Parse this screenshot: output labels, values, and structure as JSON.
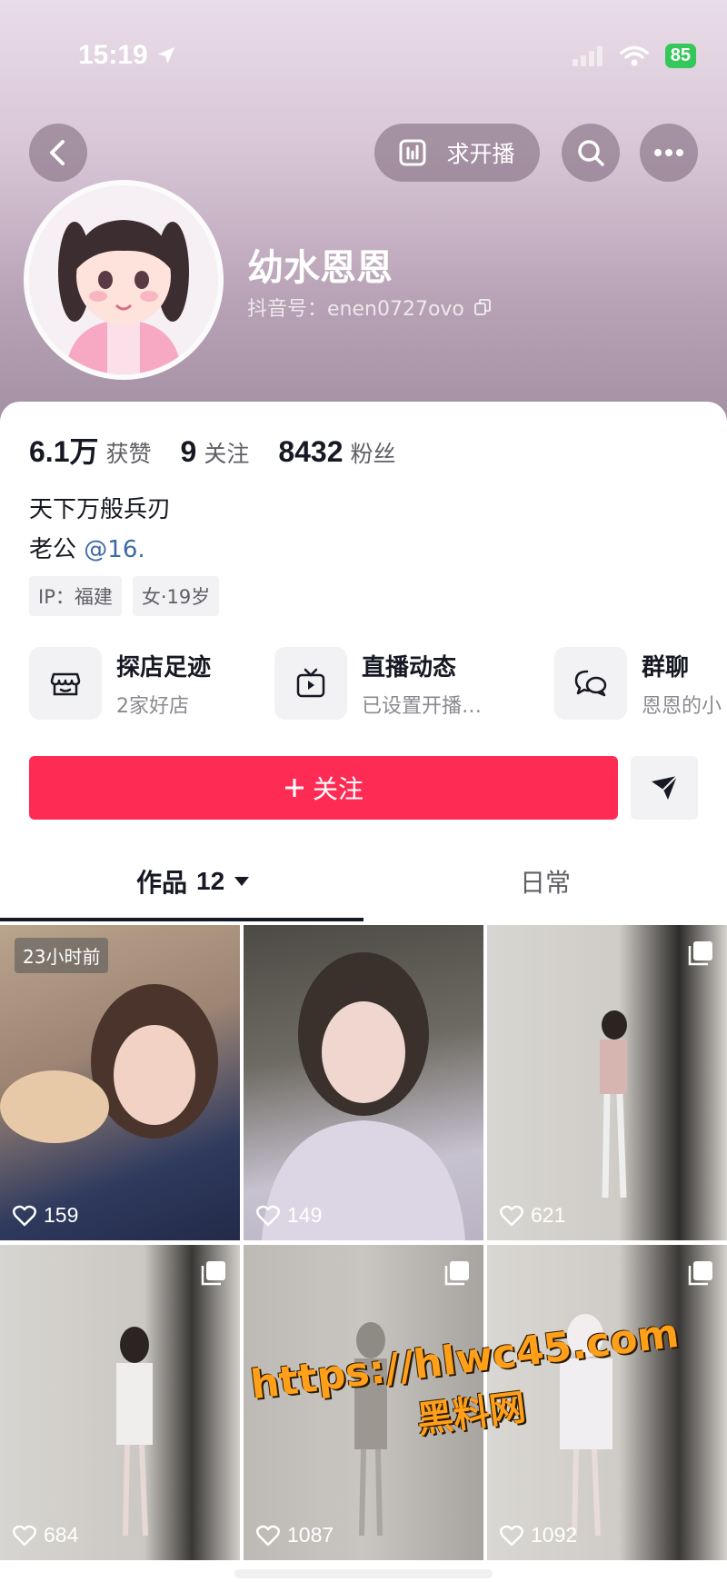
{
  "status_bar": {
    "time": "15:19",
    "battery": "85"
  },
  "header": {
    "live_request_label": "求开播",
    "username": "幼水恩恩",
    "douyin_id": "抖音号：enen0727ovo"
  },
  "stats": [
    {
      "value": "6.1万",
      "label": "获赞"
    },
    {
      "value": "9",
      "label": "关注"
    },
    {
      "value": "8432",
      "label": "粉丝"
    }
  ],
  "bio": {
    "line1": "天下万般兵刃",
    "line2_prefix": "老公",
    "line2_mention": "@16."
  },
  "tags": [
    "IP：福建",
    "女·19岁"
  ],
  "features": [
    {
      "title": "探店足迹",
      "subtitle": "2家好店",
      "icon": "store-icon"
    },
    {
      "title": "直播动态",
      "subtitle": "已设置开播…",
      "icon": "tv-icon"
    },
    {
      "title": "群聊",
      "subtitle": "恩恩的小",
      "icon": "chat-icon"
    }
  ],
  "actions": {
    "follow_label": "关注"
  },
  "tabs": {
    "works_label": "作品",
    "works_count": "12",
    "daily_label": "日常"
  },
  "posts": [
    {
      "likes": "159",
      "badge": "23小时前",
      "multi": false
    },
    {
      "likes": "149",
      "badge": "",
      "multi": false
    },
    {
      "likes": "621",
      "badge": "",
      "multi": true
    },
    {
      "likes": "684",
      "badge": "",
      "multi": true
    },
    {
      "likes": "1087",
      "badge": "",
      "multi": true
    },
    {
      "likes": "1092",
      "badge": "",
      "multi": true
    }
  ],
  "watermark": {
    "url": "https://hlwc45.com",
    "name": "黑料网"
  },
  "colors": {
    "accent": "#fe2c55",
    "mention": "#3d6aa6"
  }
}
